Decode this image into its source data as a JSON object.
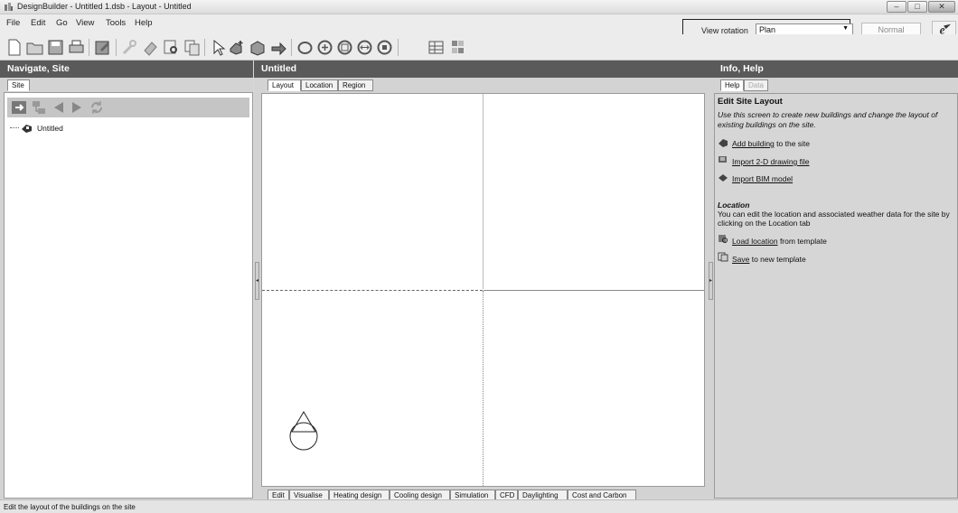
{
  "window": {
    "title": "DesignBuilder - Untitled 1.dsb - Layout - Untitled",
    "buttons": {
      "minimize": "–",
      "restore": "□",
      "close": "✕"
    }
  },
  "menu": [
    "File",
    "Edit",
    "Go",
    "View",
    "Tools",
    "Help"
  ],
  "view_rotation": {
    "label": "View rotation",
    "value": "Plan"
  },
  "display_mode": "Normal",
  "toolbar_icons": [
    "new-file-icon",
    "open-folder-icon",
    "save-icon",
    "print-icon",
    "edit-icon",
    "wrench-icon",
    "eraser-icon",
    "zoom-icon",
    "copy-icon",
    "pointer-icon",
    "add-building-icon",
    "add-block-icon",
    "import-icon",
    "orbit-icon",
    "zoom-in-icon",
    "zoom-extents-icon",
    "pan-icon",
    "zoom-window-icon",
    "grid-icon",
    "layout-icon"
  ],
  "left_panel": {
    "title": "Navigate, Site",
    "tab": "Site",
    "tree_item": "Untitled"
  },
  "center_panel": {
    "title": "Untitled",
    "top_tabs": [
      "Layout",
      "Location",
      "Region"
    ],
    "bottom_tabs": [
      "Edit",
      "Visualise",
      "Heating design",
      "Cooling design",
      "Simulation",
      "CFD",
      "Daylighting",
      "Cost and Carbon"
    ]
  },
  "right_panel": {
    "title": "Info, Help",
    "tabs": [
      "Help",
      "Data"
    ],
    "heading": "Edit Site Layout",
    "intro": "Use this screen to create new buildings and change the layout of existing buildings on the site.",
    "links": [
      {
        "link": "Add building",
        "rest": " to the site"
      },
      {
        "link": "Import 2-D drawing file",
        "rest": ""
      },
      {
        "link": "Import BIM model",
        "rest": ""
      }
    ],
    "location_heading": "Location",
    "location_text": "You can edit the location and associated weather data for the site by clicking on the Location tab",
    "location_links": [
      {
        "link": "Load location",
        "rest": " from template"
      },
      {
        "link": "Save",
        "rest": " to new template"
      }
    ]
  },
  "status_bar": "Edit the layout of the buildings on the site",
  "colors": {
    "panel_header": "#5a5a5a",
    "canvas": "#ffffff",
    "panel_bg": "#d3d3d3"
  }
}
